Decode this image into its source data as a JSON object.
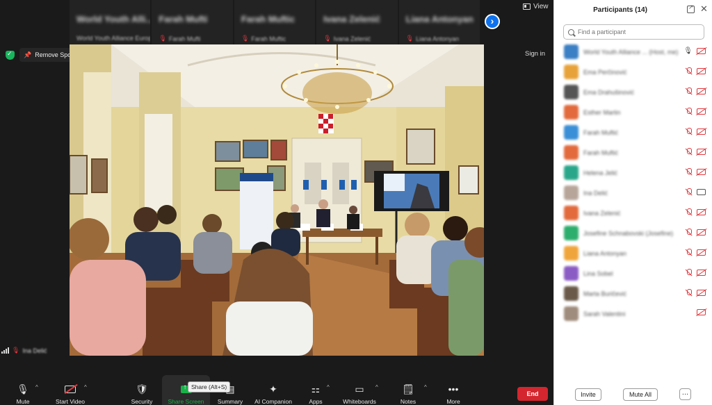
{
  "thumbnails": [
    {
      "name": "World Youth Alli...",
      "sub": "World Youth Alliance Europe",
      "muted": false
    },
    {
      "name": "Farah Mufti",
      "sub": "Farah Mufti",
      "muted": true
    },
    {
      "name": "Farah Muftic",
      "sub": "Farah Muftic",
      "muted": true
    },
    {
      "name": "Ivana Zelenić",
      "sub": "Ivana Zelenić",
      "muted": true
    },
    {
      "name": "Liana Antonyan",
      "sub": "Liana Antonyan",
      "muted": true
    }
  ],
  "top": {
    "view_label": "View",
    "remove_spotlight": "Remove Spotlight",
    "sign_in": "Sign in",
    "next_icon": "chevron-right-icon"
  },
  "video": {
    "name_tag": "Ina Delić",
    "flag_colors": [
      "#cc1e2a",
      "#ffffff"
    ]
  },
  "toolbar": {
    "mute": "Mute",
    "start_video": "Start Video",
    "security": "Security",
    "share_screen": "Share Screen",
    "share_tooltip": "Share (Alt+S)",
    "summary": "Summary",
    "ai_companion": "AI Companion",
    "apps": "Apps",
    "whiteboards": "Whiteboards",
    "notes": "Notes",
    "more": "More",
    "end": "End"
  },
  "panel": {
    "title": "Participants (14)",
    "search_placeholder": "Find a participant",
    "invite": "Invite",
    "mute_all": "Mute All",
    "participants": [
      {
        "name": "World Youth Alliance ... (Host, me)",
        "color": "#3b7fc4",
        "mic": "on",
        "cam": "off"
      },
      {
        "name": "Ema Perčinović",
        "color": "#e8a23a",
        "mic": "off",
        "cam": "off"
      },
      {
        "name": "Ema Drahušinović",
        "color": "#555555",
        "mic": "off",
        "cam": "off"
      },
      {
        "name": "Esther Martin",
        "color": "#e26a3c",
        "mic": "off",
        "cam": "off"
      },
      {
        "name": "Farah Muftić",
        "color": "#3b8fd6",
        "mic": "off",
        "cam": "off"
      },
      {
        "name": "Farah Muftić",
        "color": "#e26a3c",
        "mic": "off",
        "cam": "off"
      },
      {
        "name": "Helena Jelić",
        "color": "#2aa78a",
        "mic": "off",
        "cam": "off"
      },
      {
        "name": "Ina Delić",
        "color": "#b7a59a",
        "mic": "off",
        "cam": "on"
      },
      {
        "name": "Ivana Zelenić",
        "color": "#e26a3c",
        "mic": "off",
        "cam": "off"
      },
      {
        "name": "Josefine Schnabovski (Josefine)",
        "color": "#2eae6d",
        "mic": "off",
        "cam": "off"
      },
      {
        "name": "Liana Antonyan",
        "color": "#f0a53c",
        "mic": "off",
        "cam": "off"
      },
      {
        "name": "Lina Sobel",
        "color": "#8b5cc4",
        "mic": "off",
        "cam": "off"
      },
      {
        "name": "Marta Buričević",
        "color": "#6b5a4a",
        "mic": "off",
        "cam": "off"
      },
      {
        "name": "Sarah Valentini",
        "color": "#a08c7c",
        "mic": "none",
        "cam": "off"
      }
    ]
  }
}
